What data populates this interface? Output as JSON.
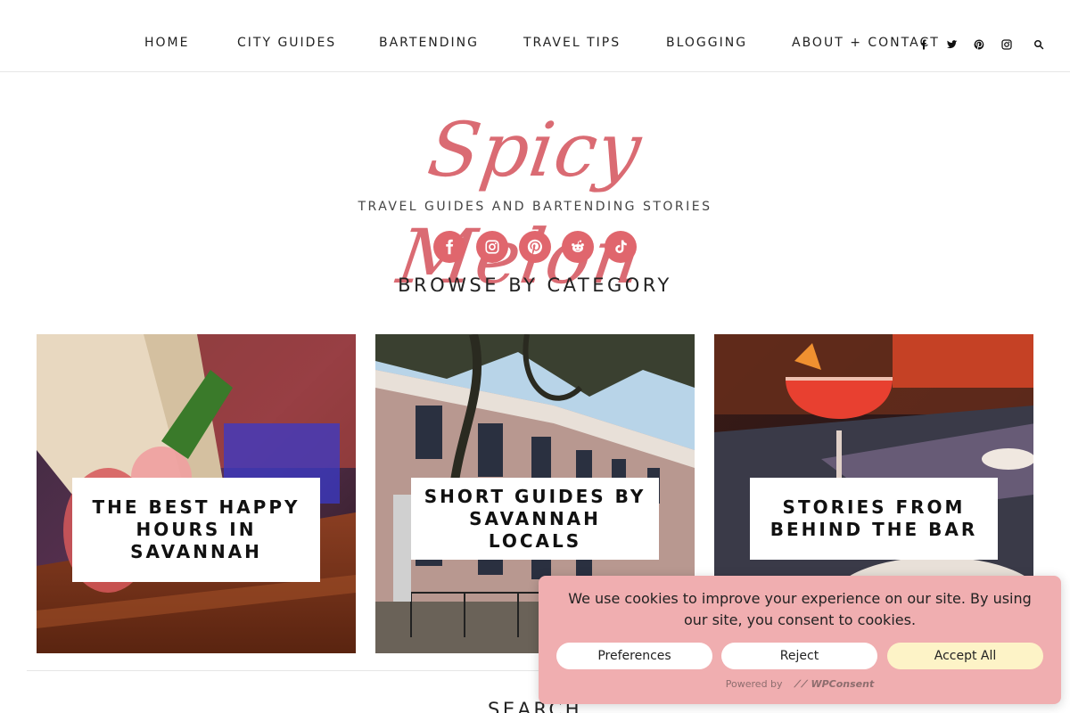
{
  "nav": {
    "items": [
      {
        "label": "HOME"
      },
      {
        "label": "CITY GUIDES"
      },
      {
        "label": "BARTENDING"
      },
      {
        "label": "TRAVEL TIPS"
      },
      {
        "label": "BLOGGING"
      },
      {
        "label": "ABOUT + CONTACT"
      }
    ],
    "social_icons": [
      "facebook-icon",
      "twitter-icon",
      "pinterest-icon",
      "instagram-icon",
      "search-icon"
    ]
  },
  "header": {
    "logo_text": "Spicy Melon",
    "tagline": "TRAVEL GUIDES AND BARTENDING STORIES",
    "social_icons": [
      "facebook-icon",
      "instagram-icon",
      "pinterest-icon",
      "reddit-icon",
      "tiktok-icon"
    ],
    "accent_color": "#e0666d"
  },
  "browse": {
    "heading": "BROWSE BY CATEGORY",
    "cards": [
      {
        "label": "THE BEST HAPPY HOURS IN SAVANNAH"
      },
      {
        "label": "SHORT GUIDES BY SAVANNAH LOCALS"
      },
      {
        "label": "STORIES FROM BEHIND THE BAR"
      }
    ]
  },
  "search": {
    "heading": "SEARCH"
  },
  "cookie": {
    "message": "We use cookies to improve your experience on our site. By using our site, you consent to cookies.",
    "preferences_label": "Preferences",
    "reject_label": "Reject",
    "accept_label": "Accept All",
    "powered_prefix": "Powered by",
    "powered_brand": "WPConsent",
    "background_color": "#f0aeb0",
    "accept_color": "#fdf3c7"
  }
}
